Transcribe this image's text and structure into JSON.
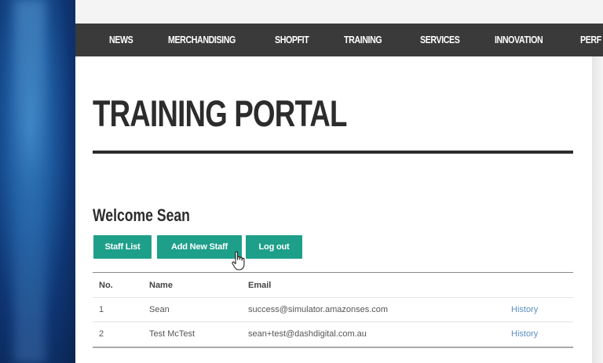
{
  "nav": {
    "items": [
      "NEWS",
      "MERCHANDISING",
      "SHOPFIT",
      "TRAINING",
      "SERVICES",
      "INNOVATION",
      "PERF"
    ]
  },
  "page": {
    "title": "TRAINING PORTAL",
    "welcome": "Welcome Sean"
  },
  "actions": {
    "staff_list": "Staff List",
    "add_new_staff": "Add New Staff",
    "log_out": "Log out"
  },
  "staff_table": {
    "headers": {
      "no": "No.",
      "name": "Name",
      "email": "Email"
    },
    "rows": [
      {
        "no": "1",
        "name": "Sean",
        "email": "success@simulator.amazonses.com",
        "action": "History"
      },
      {
        "no": "2",
        "name": "Test McTest",
        "email": "sean+test@dashdigital.com.au",
        "action": "History"
      }
    ]
  },
  "colors": {
    "nav_bg": "#3a3a3a",
    "button_bg": "#1e9f8a",
    "link": "#5a8fc2",
    "title": "#2c2c2c"
  },
  "icons": {
    "cursor": "hand-pointer-icon"
  }
}
